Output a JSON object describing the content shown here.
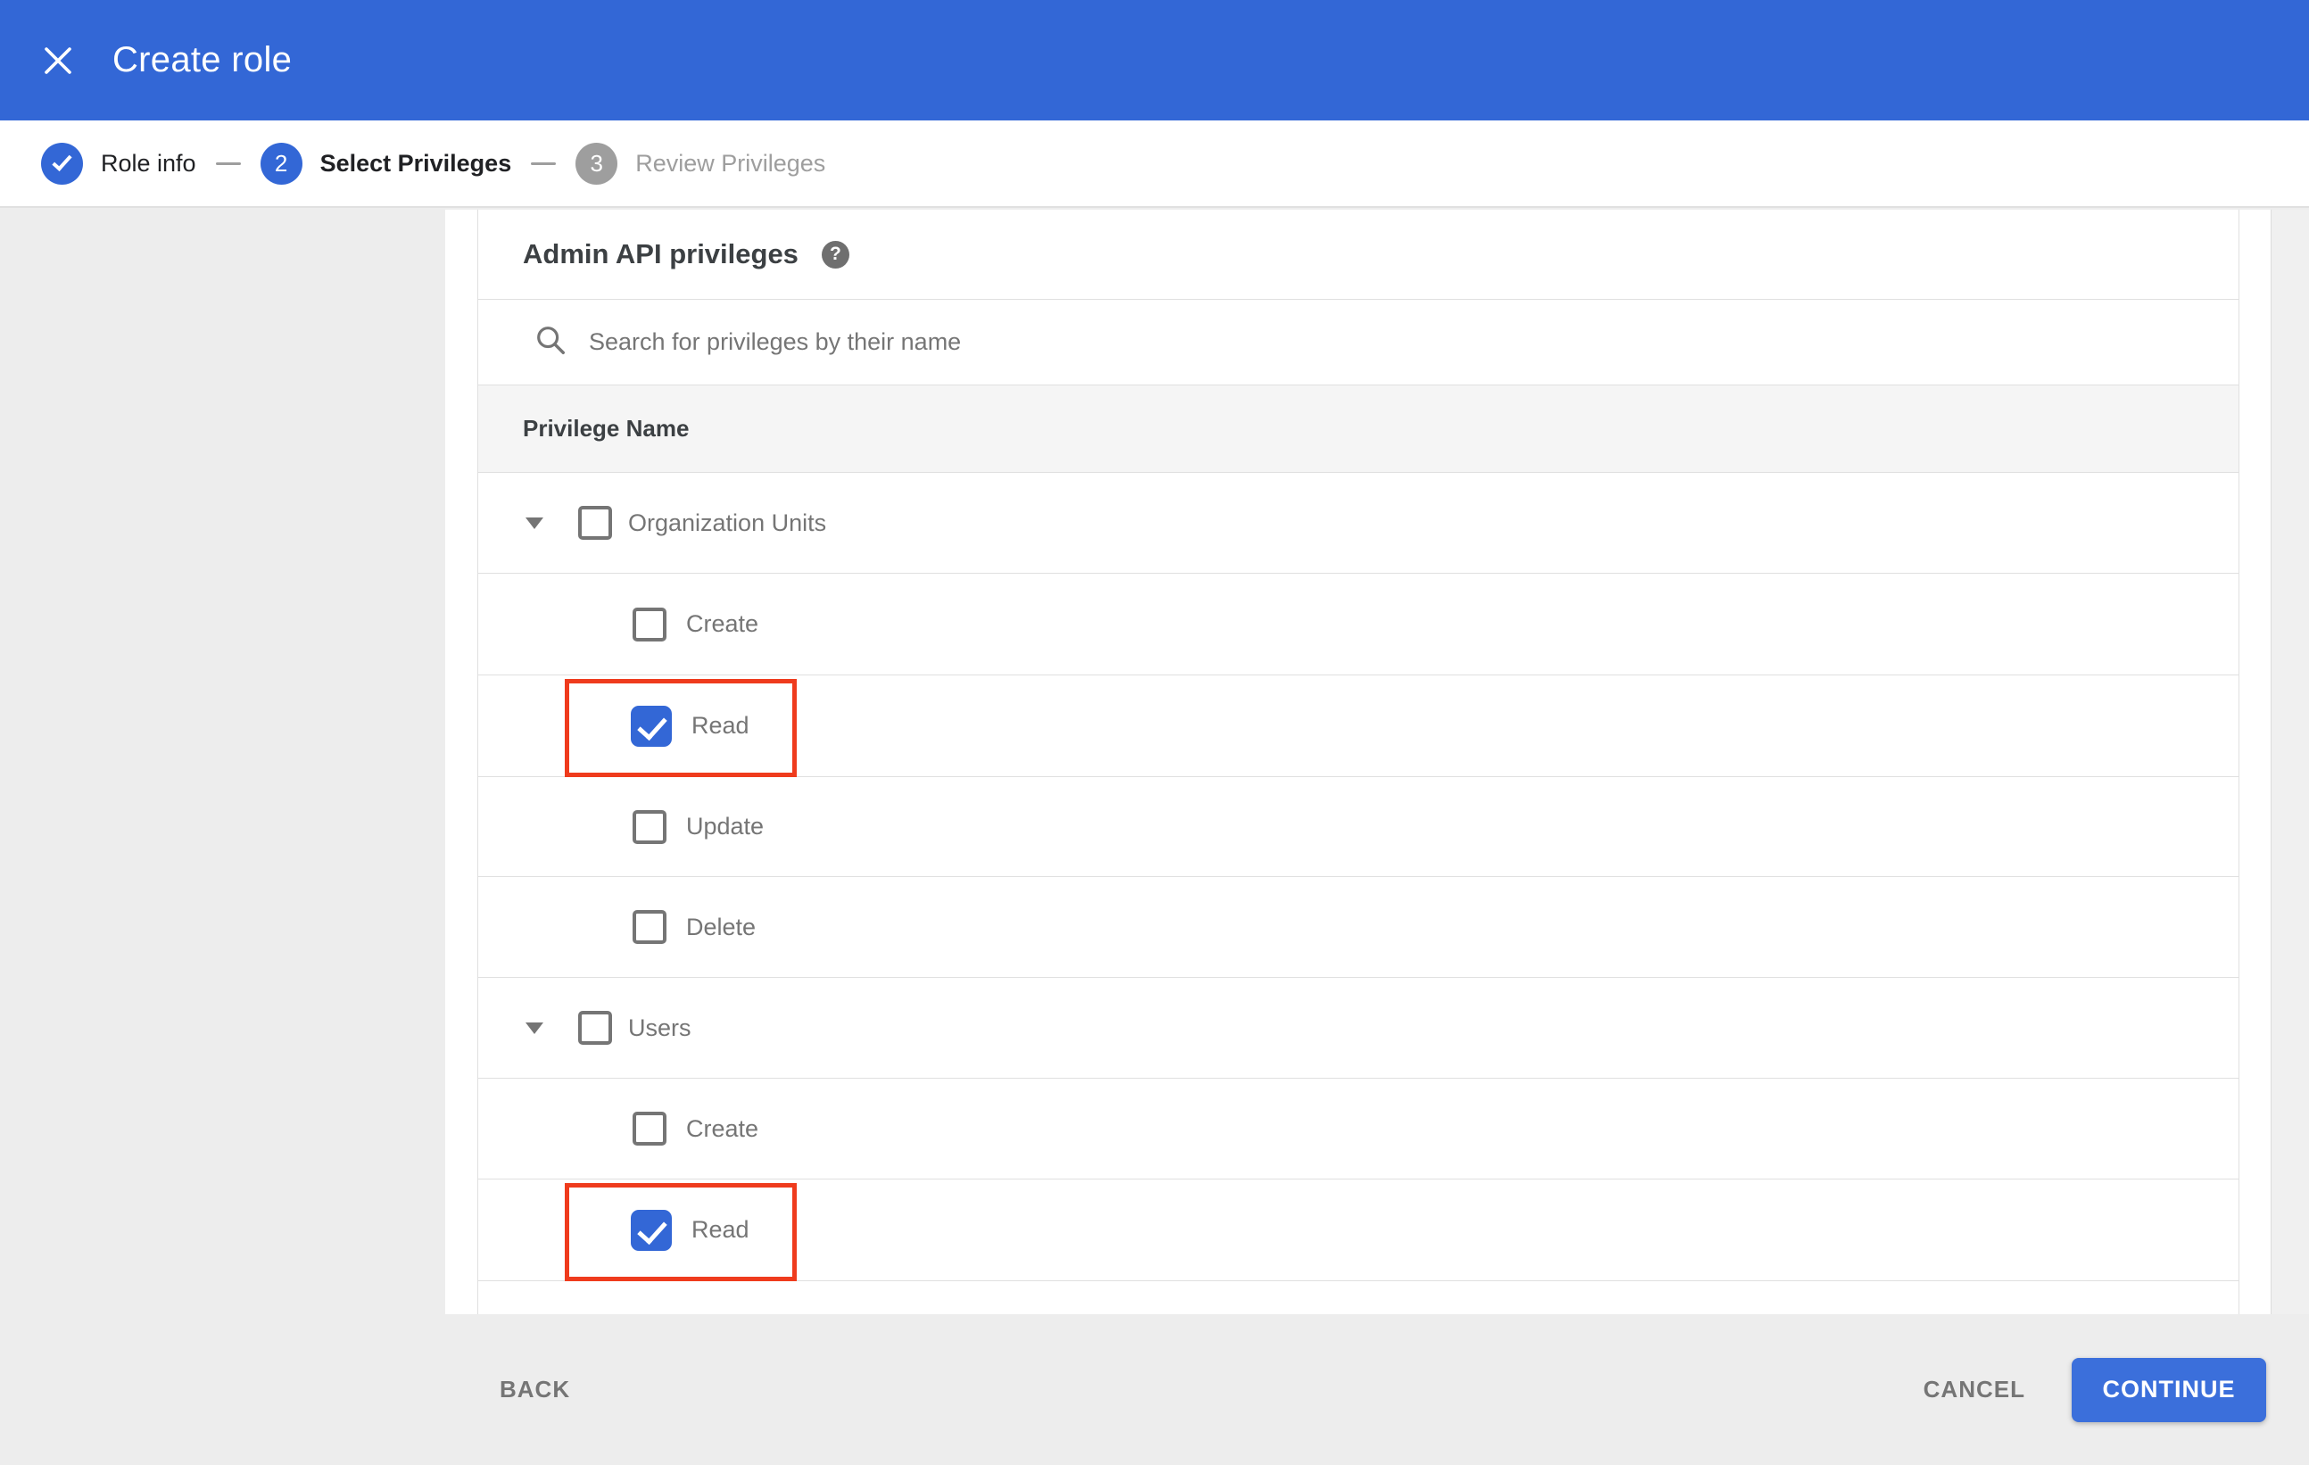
{
  "header": {
    "title": "Create role"
  },
  "stepper": {
    "steps": [
      {
        "number": "1",
        "label": "Role info",
        "state": "completed"
      },
      {
        "number": "2",
        "label": "Select Privileges",
        "state": "active"
      },
      {
        "number": "3",
        "label": "Review Privileges",
        "state": "upcoming"
      }
    ]
  },
  "content": {
    "section_title": "Admin API privileges",
    "help_glyph": "?",
    "search": {
      "placeholder": "Search for privileges by their name",
      "value": ""
    },
    "table": {
      "header": "Privilege Name",
      "groups": [
        {
          "label": "Organization Units",
          "checked": false,
          "expanded": true,
          "children": [
            {
              "label": "Create",
              "checked": false,
              "highlighted": false
            },
            {
              "label": "Read",
              "checked": true,
              "highlighted": true
            },
            {
              "label": "Update",
              "checked": false,
              "highlighted": false
            },
            {
              "label": "Delete",
              "checked": false,
              "highlighted": false
            }
          ]
        },
        {
          "label": "Users",
          "checked": false,
          "expanded": true,
          "children": [
            {
              "label": "Create",
              "checked": false,
              "highlighted": false
            },
            {
              "label": "Read",
              "checked": true,
              "highlighted": true
            }
          ]
        }
      ]
    }
  },
  "footer": {
    "back_label": "BACK",
    "cancel_label": "CANCEL",
    "continue_label": "CONTINUE"
  },
  "colors": {
    "accent_blue": "#3367d6",
    "button_blue": "#3b6fdb",
    "highlight_red": "#ef3b1d",
    "inactive_gray": "#9e9e9e",
    "row_text_gray": "#757575"
  }
}
